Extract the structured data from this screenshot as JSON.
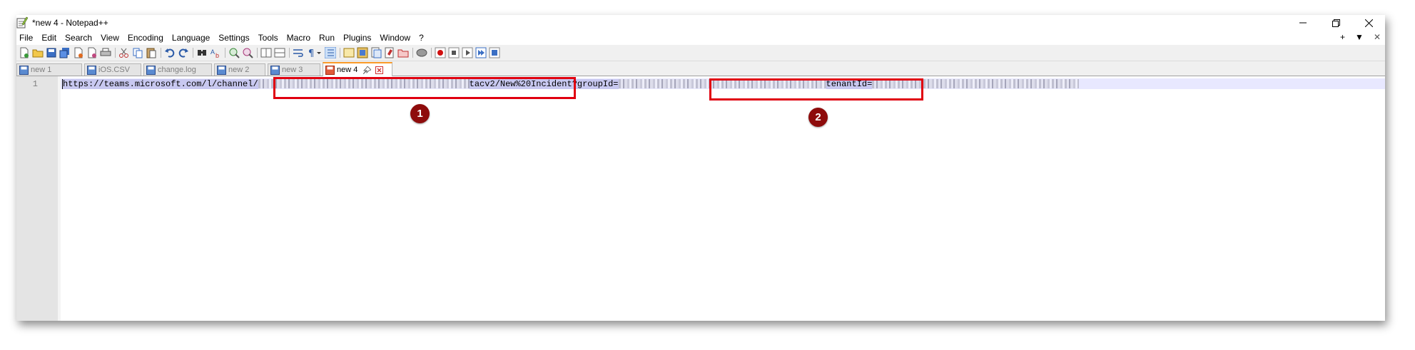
{
  "window": {
    "title": "*new 4 - Notepad++",
    "controls": {
      "minimize": "minimize",
      "maximize": "restore",
      "close": "close"
    }
  },
  "menu": {
    "items": [
      "File",
      "Edit",
      "Search",
      "View",
      "Encoding",
      "Language",
      "Settings",
      "Tools",
      "Macro",
      "Run",
      "Plugins",
      "Window",
      "?"
    ],
    "right": {
      "plus": "+",
      "dropdown": "▼",
      "close": "✕"
    }
  },
  "toolbar": {
    "icons": [
      "new-file-icon",
      "open-file-icon",
      "save-icon",
      "save-all-icon",
      "close-icon",
      "close-all-icon",
      "print-icon",
      "cut-icon",
      "copy-icon",
      "paste-icon",
      "undo-icon",
      "redo-icon",
      "find-icon",
      "replace-icon",
      "zoom-in-icon",
      "zoom-out-icon",
      "sync-vertical-icon",
      "sync-horizontal-icon",
      "word-wrap-icon",
      "show-all-chars-icon",
      "indent-guide-icon",
      "define-language-icon",
      "document-map-icon",
      "function-list-icon",
      "folder-workspace-icon",
      "monitoring-icon",
      "record-macro-icon",
      "stop-macro-icon",
      "play-macro-icon",
      "run-macro-multiple-icon",
      "save-macro-icon"
    ]
  },
  "tabs": [
    {
      "label": "new 1",
      "active": false,
      "icon": "saved-file-icon"
    },
    {
      "label": "iOS.CSV",
      "active": false,
      "icon": "saved-file-icon"
    },
    {
      "label": "change.log",
      "active": false,
      "icon": "saved-file-icon"
    },
    {
      "label": "new 2",
      "active": false,
      "icon": "saved-file-icon"
    },
    {
      "label": "new 3",
      "active": false,
      "icon": "saved-file-icon"
    },
    {
      "label": "new 4",
      "active": true,
      "icon": "unsaved-file-icon"
    }
  ],
  "editor": {
    "line_number": "1",
    "segments": {
      "prefix": "https://teams.microsoft.com/l/channel/",
      "suffix1": "tacv2",
      "middle": "/New%20Incident?groupId=",
      "middle2": "tenantId="
    }
  },
  "annotations": {
    "badge1": "1",
    "badge2": "2",
    "box_color": "#e0000f",
    "badge_color": "#8e0c0c"
  },
  "colors": {
    "active_tab_accent": "#fa9a28",
    "current_line": "#e8e8ff",
    "selection": "#c8c8f0"
  }
}
